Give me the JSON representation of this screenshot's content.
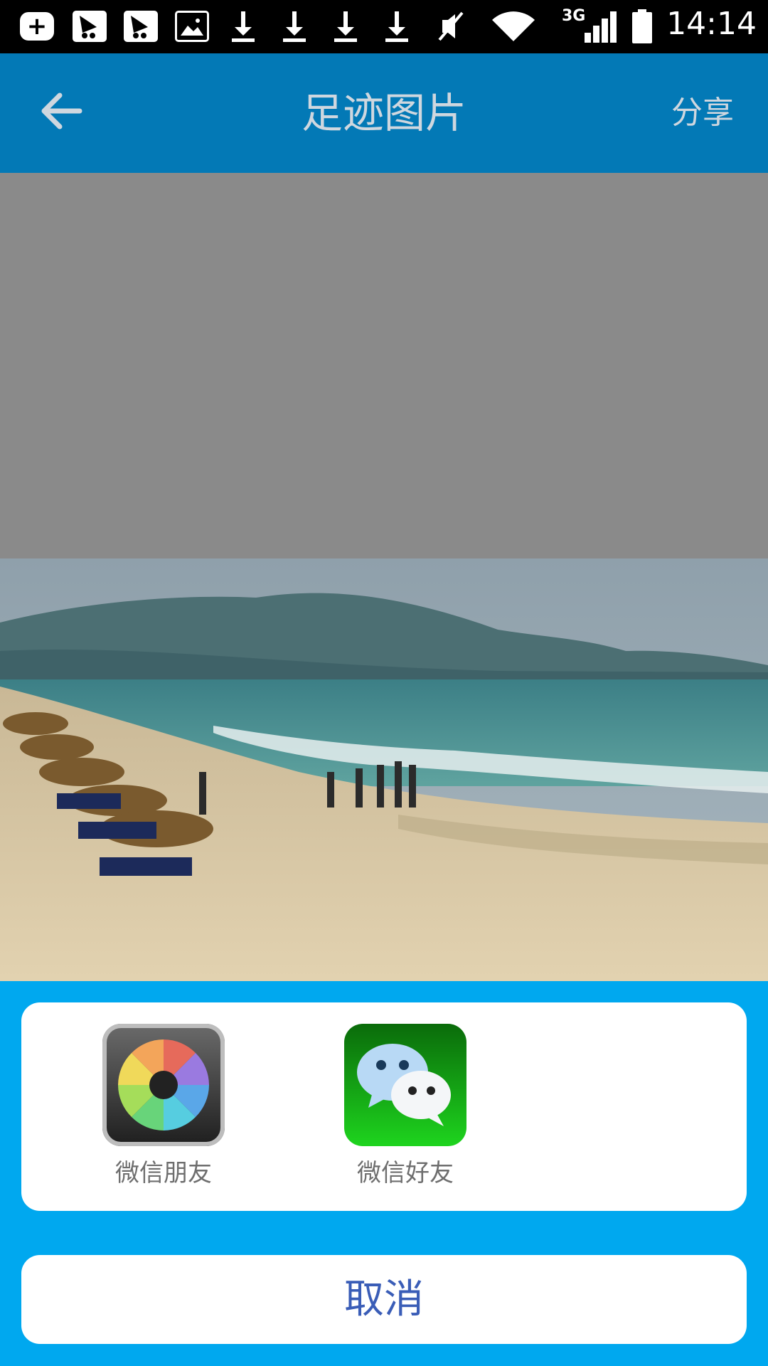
{
  "status_bar": {
    "time": "14:14",
    "network": "3G",
    "icons": [
      "plus-notification-icon",
      "windsurf-notification-icon",
      "windsurf-notification-icon",
      "image-notification-icon",
      "download-icon",
      "download-icon",
      "download-icon",
      "download-icon",
      "mute-icon",
      "wifi-icon",
      "signal-icon",
      "battery-icon"
    ]
  },
  "header": {
    "back_icon": "arrow-left-icon",
    "title": "足迹图片",
    "share_label": "分享"
  },
  "colors": {
    "header_bg": "#0379b6",
    "sheet_bg": "#00a8ef",
    "dim_overlay": "#8a8a8a",
    "cancel_text": "#3a5db7"
  },
  "share_sheet": {
    "items": [
      {
        "label": "微信朋友",
        "icon": "moments-aperture-icon"
      },
      {
        "label": "微信好友",
        "icon": "wechat-chat-icon"
      }
    ],
    "cancel_label": "取消"
  }
}
